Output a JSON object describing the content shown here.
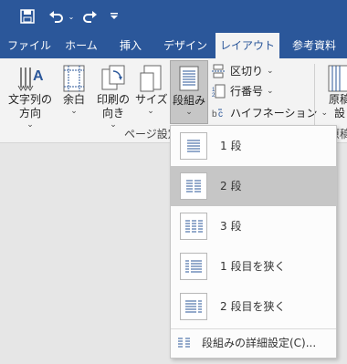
{
  "tabs": [
    "ファイル",
    "ホーム",
    "挿入",
    "デザイン",
    "レイアウト",
    "参考資料"
  ],
  "ribbon": {
    "text_direction": "文字列の\n方向",
    "margins": "余白",
    "orientation": "印刷の\n向き",
    "size": "サイズ",
    "columns": "段組み",
    "breaks": "区切り",
    "line_numbers": "行番号",
    "hyphenation": "ハイフネーション",
    "manuscript": "原稿\n設",
    "group_page_setup": "ページ設定",
    "group_manuscript": "原稿"
  },
  "columns_menu": {
    "items": [
      {
        "label": "1 段"
      },
      {
        "label": "2 段"
      },
      {
        "label": "3 段"
      },
      {
        "label": "1 段目を狭く"
      },
      {
        "label": "2 段目を狭く"
      }
    ],
    "selected_index": 1,
    "more_label": "段組みの詳細設定(C)..."
  },
  "colors": {
    "accent": "#2b579a",
    "selected": "#c6c6c6"
  }
}
